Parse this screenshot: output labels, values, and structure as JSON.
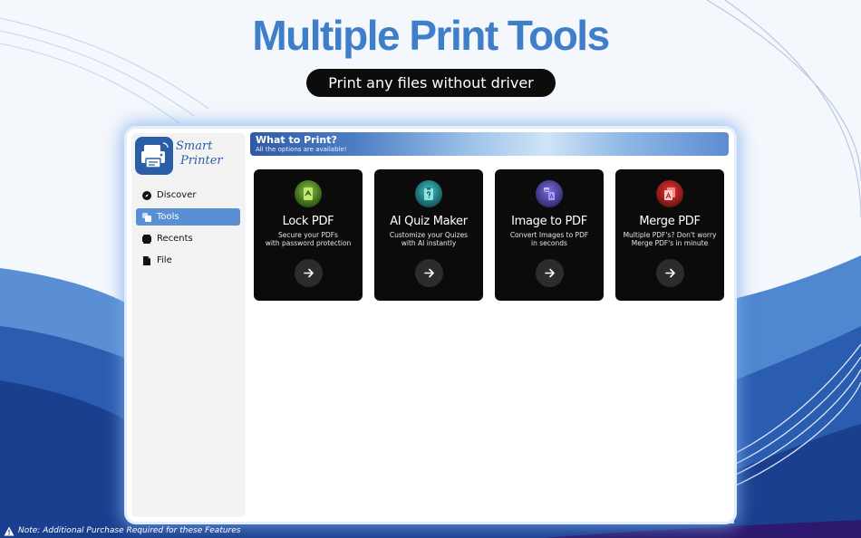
{
  "headline": "Multiple Print Tools",
  "subheadline": "Print any files without driver",
  "app": {
    "logo_line1": "Smart",
    "logo_line2": "Printer"
  },
  "sidebar": {
    "items": [
      {
        "label": "Discover",
        "icon": "compass-icon",
        "active": false
      },
      {
        "label": "Tools",
        "icon": "tools-icon",
        "active": true
      },
      {
        "label": "Recents",
        "icon": "recents-icon",
        "active": false
      },
      {
        "label": "File",
        "icon": "file-icon",
        "active": false
      }
    ]
  },
  "banner": {
    "title": "What to Print?",
    "subtitle": "All the options are available!"
  },
  "cards": [
    {
      "title": "Lock PDF",
      "desc_line1": "Secure your PDFs",
      "desc_line2": "with password protection",
      "icon": "lock-pdf-icon",
      "icon_color": "#8bc34a"
    },
    {
      "title": "AI Quiz Maker",
      "desc_line1": "Customize your Quizes",
      "desc_line2": "with AI instantly",
      "icon": "quiz-icon",
      "icon_color": "#2bb3b3"
    },
    {
      "title": "Image to PDF",
      "desc_line1": "Convert Images to PDF",
      "desc_line2": "in seconds",
      "icon": "image-to-pdf-icon",
      "icon_color": "#6a5acd"
    },
    {
      "title": "Merge PDF",
      "desc_line1": "Multiple PDF's? Don't worry",
      "desc_line2": "Merge PDF's in minute",
      "icon": "merge-pdf-icon",
      "icon_color": "#e53935"
    }
  ],
  "footnote": "Note: Additional Purchase Required for these Features",
  "colors": {
    "accent": "#3f7fc9",
    "sidebar_active": "#5a8fd4",
    "card_bg": "#0b0b0b",
    "wave_dark": "#1b3f8f"
  }
}
